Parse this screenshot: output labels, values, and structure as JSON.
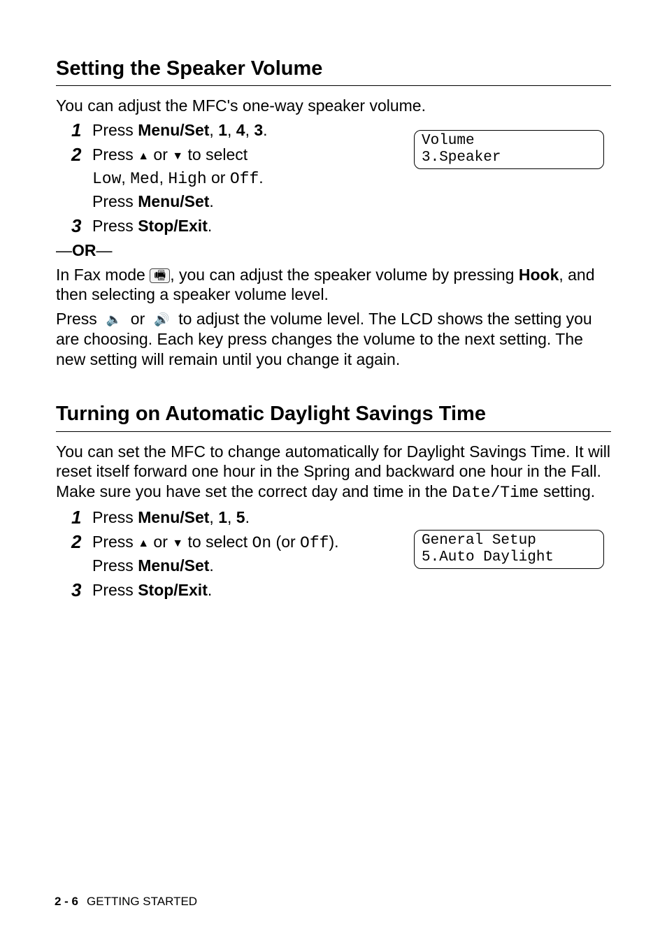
{
  "section1": {
    "title": "Setting the Speaker Volume",
    "intro": "You can adjust the MFC's one-way speaker volume.",
    "lcd": {
      "line1": "Volume",
      "line2": "3.Speaker"
    },
    "steps": {
      "s1_pre": "Press ",
      "s1_bold": "Menu/Set",
      "s1_seq": ", ",
      "s1_k1": "1",
      "s1_k2": "4",
      "s1_k3": "3",
      "s1_end": ".",
      "s2_pre": "Press ",
      "s2_mid": " or ",
      "s2_tail": " to select",
      "s2_opts_pre": "",
      "s2_low": "Low",
      "s2_med": "Med",
      "s2_high": "High",
      "s2_off": "Off",
      "s2_or": " or ",
      "s2_comma": ", ",
      "s2_dot": ".",
      "s2_press": "Press ",
      "s2_menuset": "Menu/Set",
      "s3_pre": "Press ",
      "s3_bold": "Stop/Exit",
      "s3_dot": "."
    },
    "or_dash": "—",
    "or": "OR",
    "fax_p1a": "In Fax mode ",
    "fax_p1b": ", you can adjust the speaker volume by pressing ",
    "hook": "Hook",
    "fax_p1c": ", and then selecting a speaker volume level.",
    "vol_p_a": "Press ",
    "vol_p_b": " or ",
    "vol_p_c": " to adjust the volume level. The LCD shows the setting you are choosing. Each key press changes the volume to the next setting. The new setting will remain until you change it again."
  },
  "section2": {
    "title": "Turning on Automatic Daylight Savings Time",
    "intro_a": "You can set the MFC to change automatically for Daylight Savings Time. It will reset itself forward one hour in the Spring and backward one hour in the Fall. Make sure you have set the correct day and time in the ",
    "intro_mono": "Date/Time",
    "intro_b": " setting.",
    "lcd": {
      "line1": "General Setup",
      "line2": "5.Auto Daylight"
    },
    "steps": {
      "s1_pre": "Press ",
      "s1_bold": "Menu/Set",
      "s1_seq": ", ",
      "s1_k1": "1",
      "s1_k2": "5",
      "s1_dot": ".",
      "s2_pre": "Press ",
      "s2_mid": " or ",
      "s2_tail": " to select ",
      "s2_on": "On",
      "s2_paren_open": " (or ",
      "s2_off": "Off",
      "s2_paren_close": ").",
      "s2_press": "Press ",
      "s2_menuset": "Menu/Set",
      "s2_menudot": ".",
      "s3_pre": "Press ",
      "s3_bold": "Stop/Exit",
      "s3_dot": "."
    }
  },
  "footer": {
    "page": "2 - 6",
    "chapter": "GETTING STARTED"
  }
}
